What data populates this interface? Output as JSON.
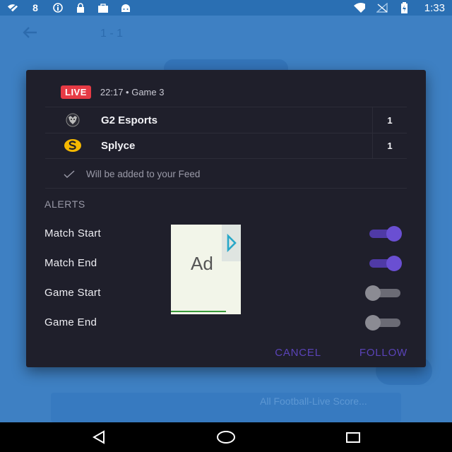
{
  "status_bar": {
    "time": "1:33",
    "icons": [
      "wifi-off-icon",
      "number-8-icon",
      "info-icon",
      "lock-icon",
      "briefcase-icon",
      "android-icon",
      "wifi-icon",
      "no-signal-icon",
      "battery-charging-icon"
    ]
  },
  "background": {
    "score": "1 - 1",
    "ad_title": "All Football-Live Score..."
  },
  "dialog": {
    "live_label": "LIVE",
    "match_time": "22:17 • Game 3",
    "teams": [
      {
        "name": "G2 Esports",
        "score": "1",
        "logo": "g2-logo-icon"
      },
      {
        "name": "Splyce",
        "score": "1",
        "logo": "splyce-logo-icon"
      }
    ],
    "feed_text": "Will be added to your Feed",
    "alerts_title": "ALERTS",
    "alerts": [
      {
        "label": "Match Start",
        "enabled": true
      },
      {
        "label": "Match End",
        "enabled": true
      },
      {
        "label": "Game Start",
        "enabled": false
      },
      {
        "label": "Game End",
        "enabled": false
      }
    ],
    "cancel_label": "CANCEL",
    "follow_label": "FOLLOW"
  },
  "ad": {
    "label": "Ad",
    "icon": "ad-choices-icon"
  },
  "colors": {
    "accent": "#5a43b8",
    "live": "#e63b45",
    "dialog_bg": "#1f1f2b",
    "app_bg": "#4a90d2"
  }
}
